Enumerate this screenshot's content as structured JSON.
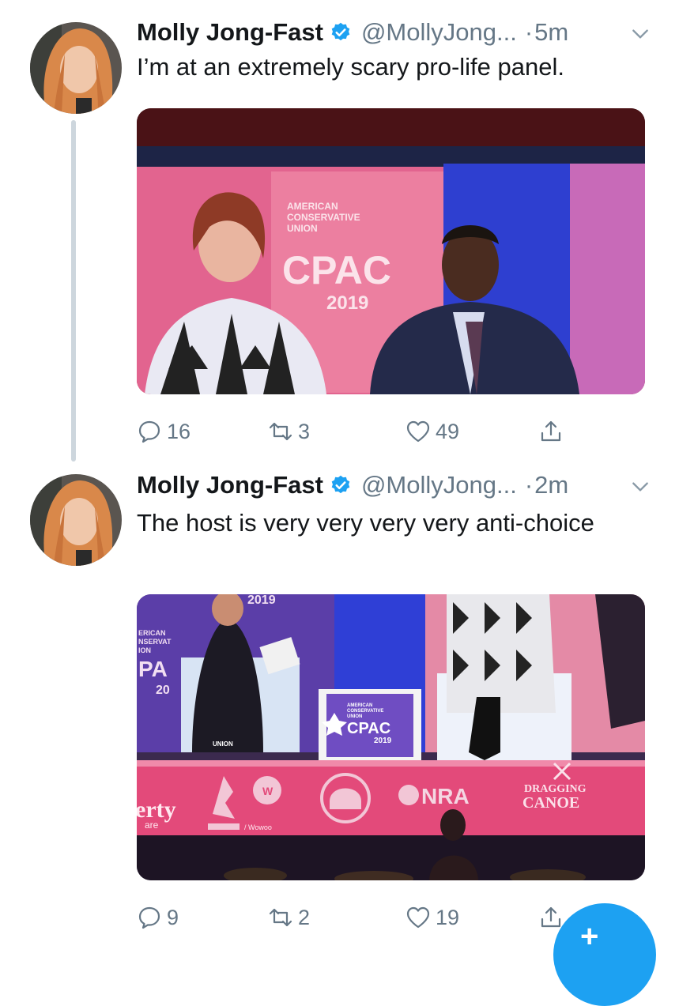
{
  "tweets": [
    {
      "name": "Molly Jong-Fast",
      "handle": "@MollyJong...",
      "time": "5m",
      "text": "I’m at an extremely scary pro-life panel.",
      "media": {
        "sign_lines": [
          "AMERICAN",
          "CONSERVATIVE",
          "UNION"
        ],
        "sign_logo": "CPAC",
        "sign_year": "2019"
      },
      "replies": "16",
      "retweets": "3",
      "likes": "49"
    },
    {
      "name": "Molly Jong-Fast",
      "handle": "@MollyJong...",
      "time": "2m",
      "text": "The host is very very very very anti-choice",
      "media": {
        "top_year": "2019",
        "left_sign_lines": [
          "ERICAN",
          "NSERVAT",
          "ION"
        ],
        "left_sign_logo": "PA",
        "left_sign_year": "20",
        "center_lines": [
          "AMERICAN",
          "CONSERVATIVE",
          "UNION"
        ],
        "center_logo": "CPAC",
        "center_year": "2019",
        "union_label": "UNION",
        "banner_left": "erty",
        "banner_left_sub": "are",
        "banner_w": "W",
        "banner_mid_small": "/ Wowoo",
        "banner_nra": "NRA",
        "banner_dragging": "DRAGGING",
        "banner_canoe": "CANOE"
      },
      "replies": "9",
      "retweets": "2",
      "likes": "19"
    }
  ],
  "separator_dot": "·",
  "colors": {
    "accent": "#1da1f2",
    "muted": "#657786",
    "text": "#14171a",
    "thread_line": "#cdd6dd"
  },
  "icons": {
    "reply": "reply-icon",
    "retweet": "retweet-icon",
    "like": "heart-icon",
    "share": "share-icon",
    "verified": "verified-badge-icon",
    "caret": "chevron-down-icon",
    "compose": "compose-tweet-icon"
  }
}
